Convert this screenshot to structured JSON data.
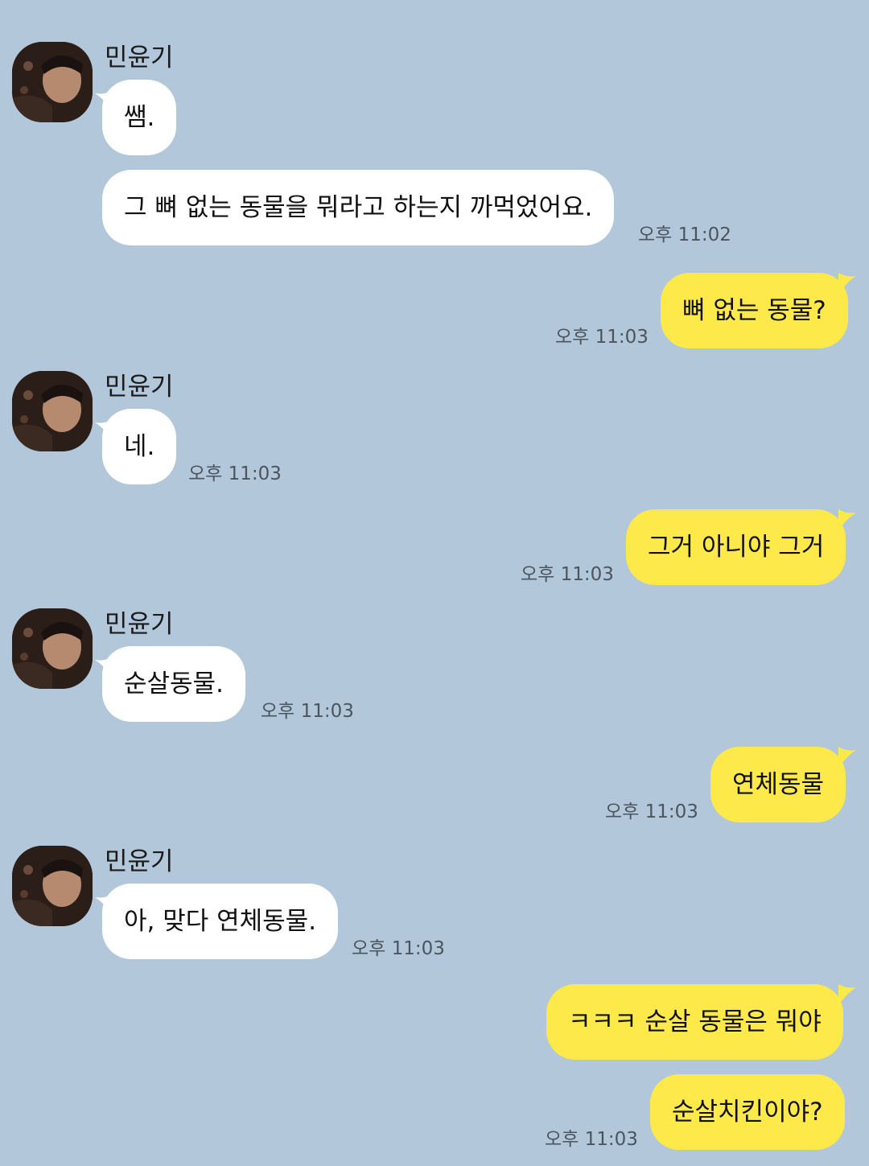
{
  "chat": {
    "contact_name": "민윤기",
    "messages": [
      {
        "from": "them",
        "text": "쌤."
      },
      {
        "from": "them",
        "text": "그 뼈 없는 동물을 뭐라고 하는지 까먹었어요.",
        "time": "오후 11:02"
      },
      {
        "from": "me",
        "text": "뼈 없는 동물?",
        "time": "오후 11:03"
      },
      {
        "from": "them",
        "text": "네.",
        "time": "오후 11:03"
      },
      {
        "from": "me",
        "text": "그거 아니야 그거",
        "time": "오후 11:03"
      },
      {
        "from": "them",
        "text": "순살동물.",
        "time": "오후 11:03"
      },
      {
        "from": "me",
        "text": "연체동물",
        "time": "오후 11:03"
      },
      {
        "from": "them",
        "text": "아, 맞다 연체동물.",
        "time": "오후 11:03"
      },
      {
        "from": "me",
        "text": "ㅋㅋㅋ 순살 동물은 뭐야"
      },
      {
        "from": "me",
        "text": "순살치킨이야?",
        "time": "오후 11:03"
      }
    ]
  },
  "colors": {
    "background": "#b2c7da",
    "incoming_bubble": "#ffffff",
    "outgoing_bubble": "#fee94b"
  },
  "icons": {
    "avatar": "profile-photo"
  }
}
